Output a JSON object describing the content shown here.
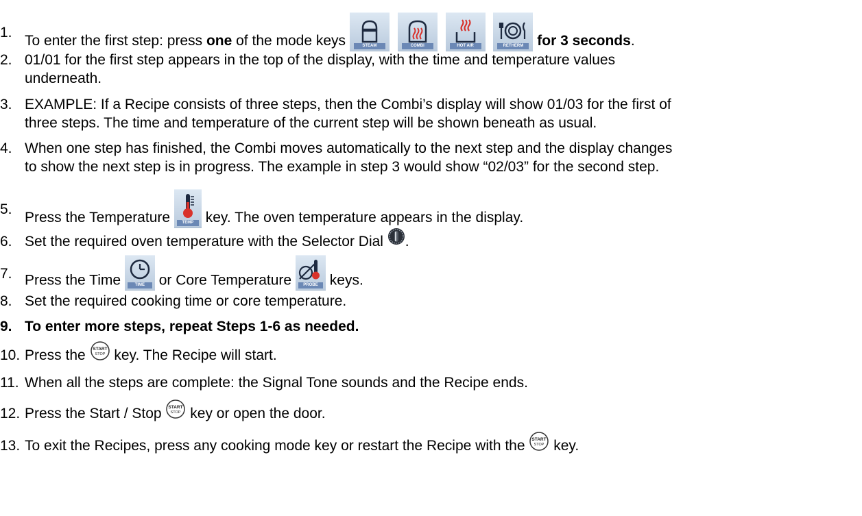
{
  "steps": [
    {
      "num": "1.",
      "pre": "To enter the first step: press ",
      "bold_mid": "one",
      "mid": " of the mode keys ",
      "bold_end": "for 3 seconds",
      "end": "."
    },
    {
      "num": "2.",
      "line1": "01/01 for the first step appears in the top of the display, with the time and temperature values",
      "line2": "underneath."
    },
    {
      "num": "3.",
      "line1": "EXAMPLE: If a Recipe consists of three steps, then the Combi’s display will show 01/03 for the first of",
      "line2": "three steps. The time and temperature of the current step will be shown beneath as usual."
    },
    {
      "num": "4.",
      "line1": "When one step has finished, the Combi moves automatically to the next step and the display changes",
      "line2": "to show the next step is in progress. The example in step 3 would show “02/03” for the second step."
    },
    {
      "num": "5.",
      "pre": "Press the Temperature ",
      "post": " key. The oven temperature appears in the display."
    },
    {
      "num": "6.",
      "pre": "Set the required oven temperature with the Selector Dial ",
      "post": "."
    },
    {
      "num": "7.",
      "pre": "Press the Time ",
      "mid": " or Core Temperature ",
      "post": " keys."
    },
    {
      "num": "8.",
      "text": "Set the required cooking time or core temperature."
    },
    {
      "num": "9.",
      "text": "To enter more steps, repeat Steps 1-6 as needed."
    },
    {
      "num": "10.",
      "pre": "Press the ",
      "post": " key. The Recipe will start."
    },
    {
      "num": "11.",
      "text": "When all the steps are complete: the Signal Tone sounds and the Recipe ends."
    },
    {
      "num": "12.",
      "pre": "Press the Start / Stop ",
      "post": " key or open the door."
    },
    {
      "num": "13.",
      "pre": "To exit the Recipes, press any cooking mode key or restart the Recipe with the ",
      "post": " key."
    }
  ],
  "icons": {
    "steam_label": "STEAM",
    "combi_label": "COMBI",
    "hotair_label": "HOT AIR",
    "retherm_label": "RETHERM",
    "temp_label": "TEMP",
    "time_label": "TIME",
    "probe_label": "PROBE",
    "start_label": "START",
    "stop_label": "STOP"
  },
  "colors": {
    "key_bg": "#c9d8e8",
    "key_label_bar": "#6b88b5",
    "heat_red": "#d9322b",
    "icon_dark": "#1e2a40"
  }
}
